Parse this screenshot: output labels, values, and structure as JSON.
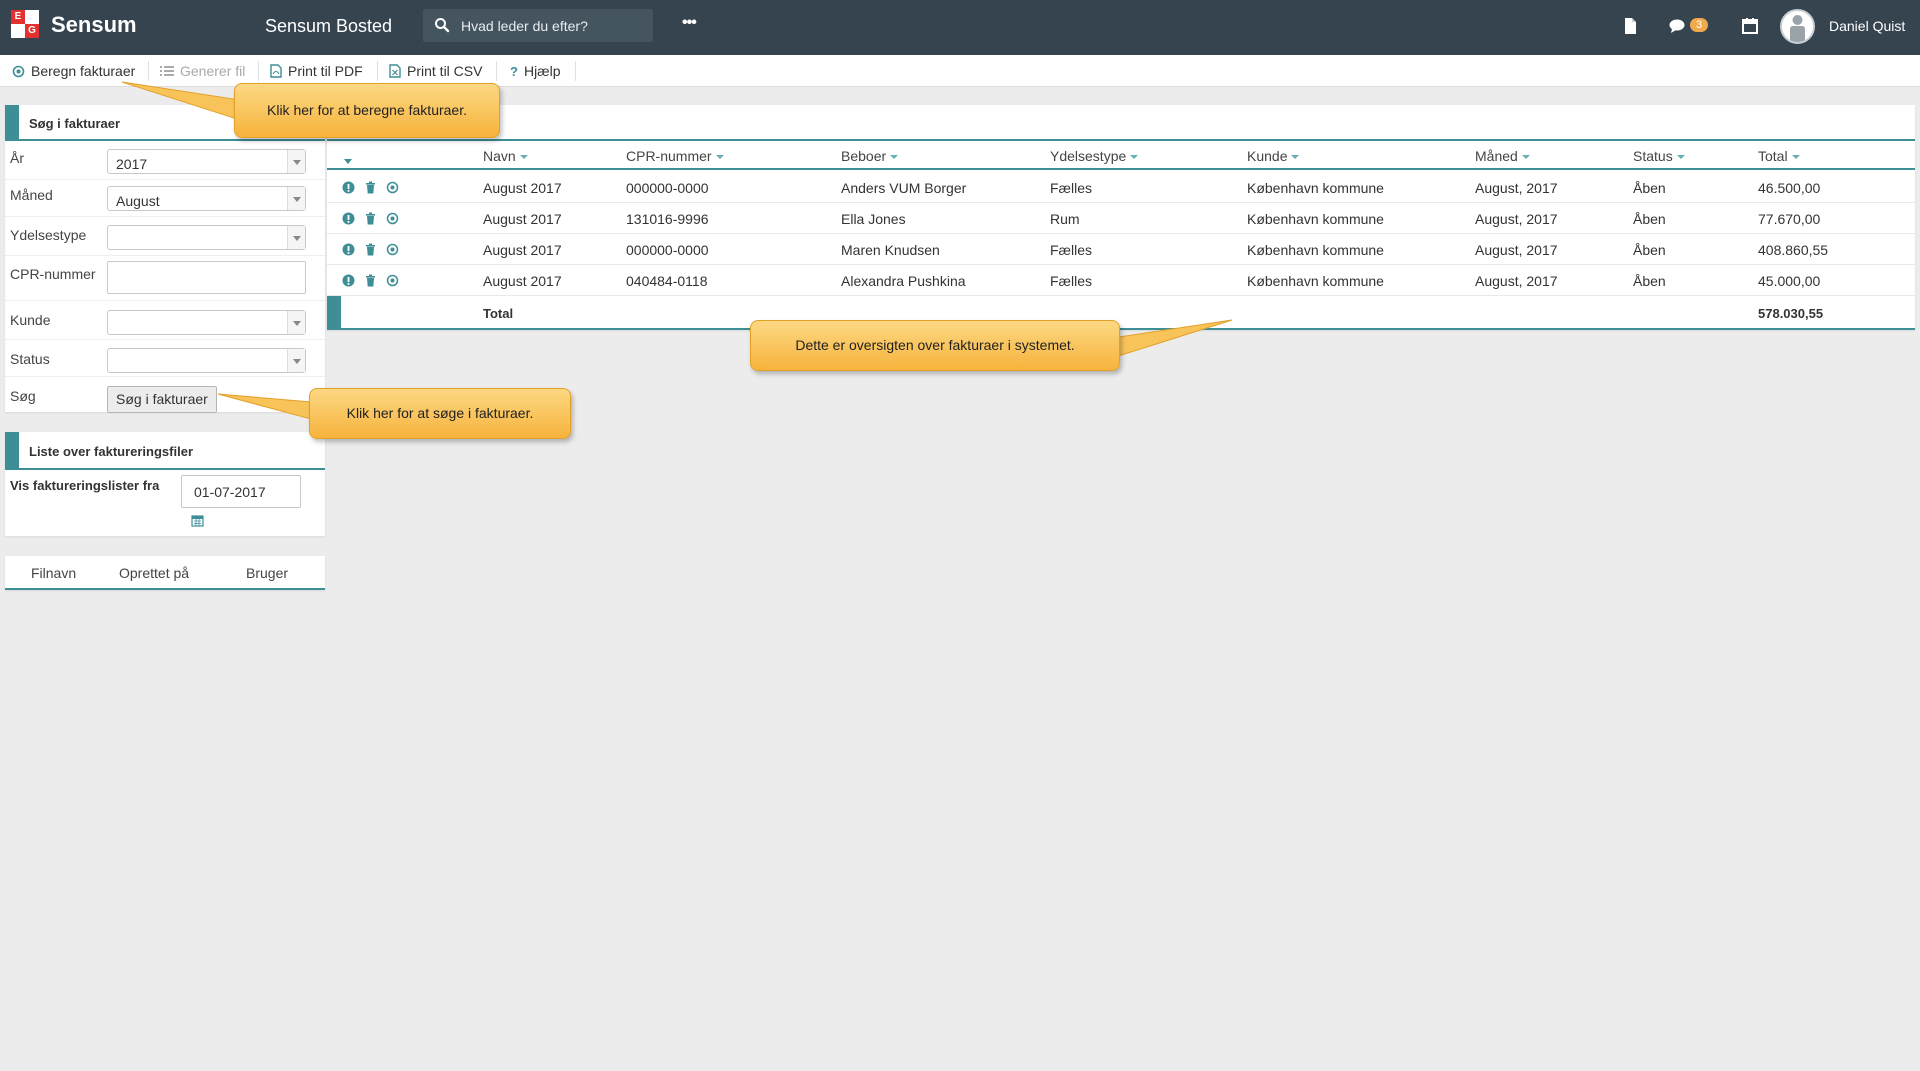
{
  "header": {
    "brand": "Sensum",
    "logo_letters": [
      "E",
      "",
      "",
      "G"
    ],
    "app_title": "Sensum Bosted",
    "search_placeholder": "Hvad leder du efter?",
    "more_label": "•••",
    "messages_count": "3",
    "user_name": "Daniel Quist"
  },
  "toolbar": {
    "items": [
      {
        "label": "Beregn fakturaer",
        "icon": "target-icon",
        "enabled": true
      },
      {
        "label": "Generer fil",
        "icon": "list-icon",
        "enabled": false
      },
      {
        "label": "Print til PDF",
        "icon": "pdf-file-icon",
        "enabled": true
      },
      {
        "label": "Print til CSV",
        "icon": "csv-file-icon",
        "enabled": true
      },
      {
        "label": "Hjælp",
        "icon": "question-icon",
        "enabled": true
      }
    ]
  },
  "search_panel": {
    "title": "Søg i fakturaer",
    "fields": {
      "year": {
        "label": "År",
        "value": "2017"
      },
      "month": {
        "label": "Måned",
        "value": "August"
      },
      "benefit_type": {
        "label": "Ydelsestype",
        "value": ""
      },
      "cpr": {
        "label": "CPR-nummer",
        "value": ""
      },
      "customer": {
        "label": "Kunde",
        "value": ""
      },
      "status": {
        "label": "Status",
        "value": ""
      },
      "search": {
        "label": "Søg",
        "button": "Søg i fakturaer"
      }
    }
  },
  "files_panel": {
    "title": "Liste over faktureringsfiler",
    "from_label": "Vis faktureringslister fra",
    "from_value": "01-07-2017",
    "columns": [
      "Filnavn",
      "Oprettet på",
      "Bruger"
    ]
  },
  "invoice_table": {
    "columns": [
      "Navn",
      "CPR-nummer",
      "Beboer",
      "Ydelsestype",
      "Kunde",
      "Måned",
      "Status",
      "Total"
    ],
    "rows": [
      [
        "August 2017",
        "000000-0000",
        "Anders VUM Borger",
        "Fælles",
        "København kommune",
        "August, 2017",
        "Åben",
        "46.500,00"
      ],
      [
        "August 2017",
        "131016-9996",
        "Ella Jones",
        "Rum",
        "København kommune",
        "August, 2017",
        "Åben",
        "77.670,00"
      ],
      [
        "August 2017",
        "000000-0000",
        "Maren Knudsen",
        "Fælles",
        "København kommune",
        "August, 2017",
        "Åben",
        "408.860,55"
      ],
      [
        "August 2017",
        "040484-0118",
        "Alexandra Pushkina",
        "Fælles",
        "København kommune",
        "August, 2017",
        "Åben",
        "45.000,00"
      ]
    ],
    "total_label": "Total",
    "total_value": "578.030,55"
  },
  "tooltips": {
    "calculate": "Klik her for at beregne fakturaer.",
    "search": "Klik her for at søge i fakturaer.",
    "overview": "Dette er oversigten over fakturaer i systemet."
  },
  "colors": {
    "topbar": "#35444f",
    "accent": "#3d8e95",
    "tooltip": "#f7b33c",
    "badge": "#f0a94b"
  }
}
